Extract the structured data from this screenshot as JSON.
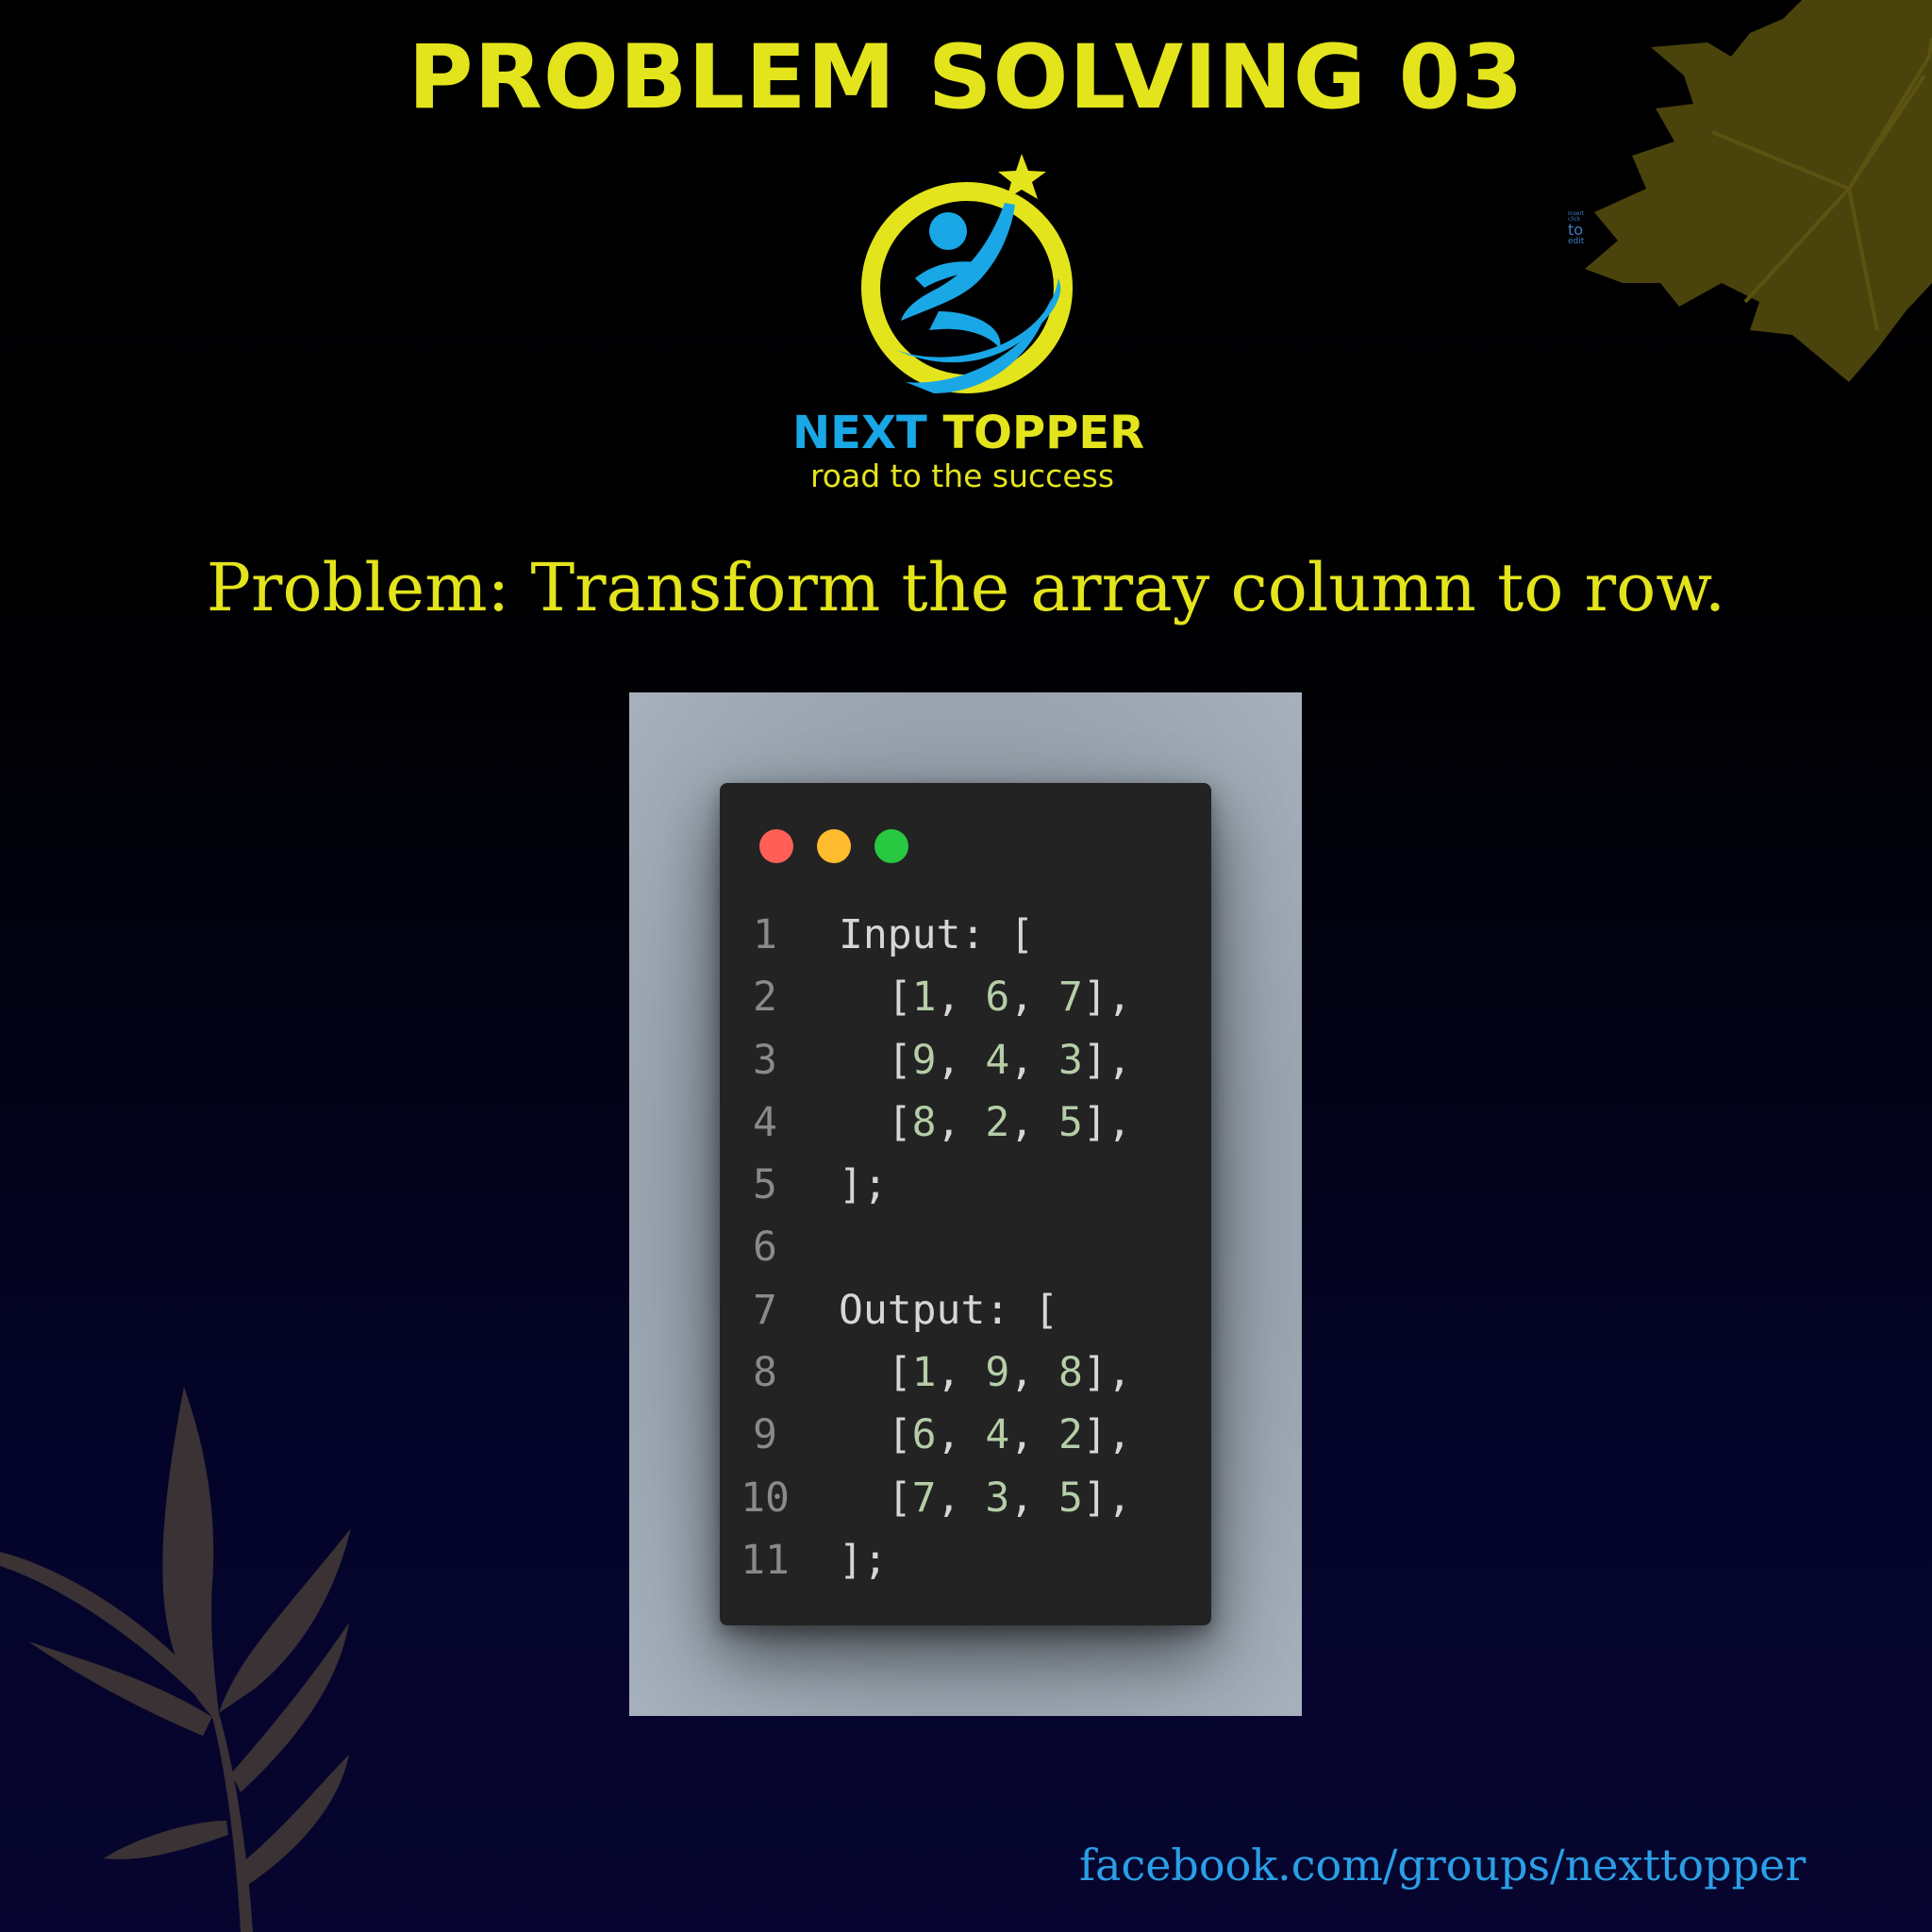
{
  "title": "PROBLEM SOLVING 03",
  "edit_hint": [
    "Insert",
    "click",
    "to",
    "edit"
  ],
  "logo": {
    "brand_part1": "NEXT",
    "brand_part2": "TOPPER",
    "tagline": "road to the success"
  },
  "problem_text": "Problem: Transform the array column to row.",
  "code_window": {
    "lines": [
      {
        "num": "1",
        "text": "Input: ["
      },
      {
        "num": "2",
        "text": "  [1, 6, 7],"
      },
      {
        "num": "3",
        "text": "  [9, 4, 3],"
      },
      {
        "num": "4",
        "text": "  [8, 2, 5],"
      },
      {
        "num": "5",
        "text": "];"
      },
      {
        "num": "6",
        "text": ""
      },
      {
        "num": "7",
        "text": "Output: ["
      },
      {
        "num": "8",
        "text": "  [1, 9, 8],"
      },
      {
        "num": "9",
        "text": "  [6, 4, 2],"
      },
      {
        "num": "10",
        "text": "  [7, 3, 5],"
      },
      {
        "num": "11",
        "text": "];"
      }
    ]
  },
  "footer_url": "facebook.com/groups/nexttopper",
  "colors": {
    "accent_yellow": "#e3e41c",
    "brand_blue": "#1aa7e6",
    "link_blue": "#2a9fe6",
    "leaf_olive": "#4a430c",
    "leaf_gray": "#3a3234",
    "code_bg": "#232323",
    "dot_red": "#ff5f57",
    "dot_yellow": "#febc2e",
    "dot_green": "#28c840"
  }
}
